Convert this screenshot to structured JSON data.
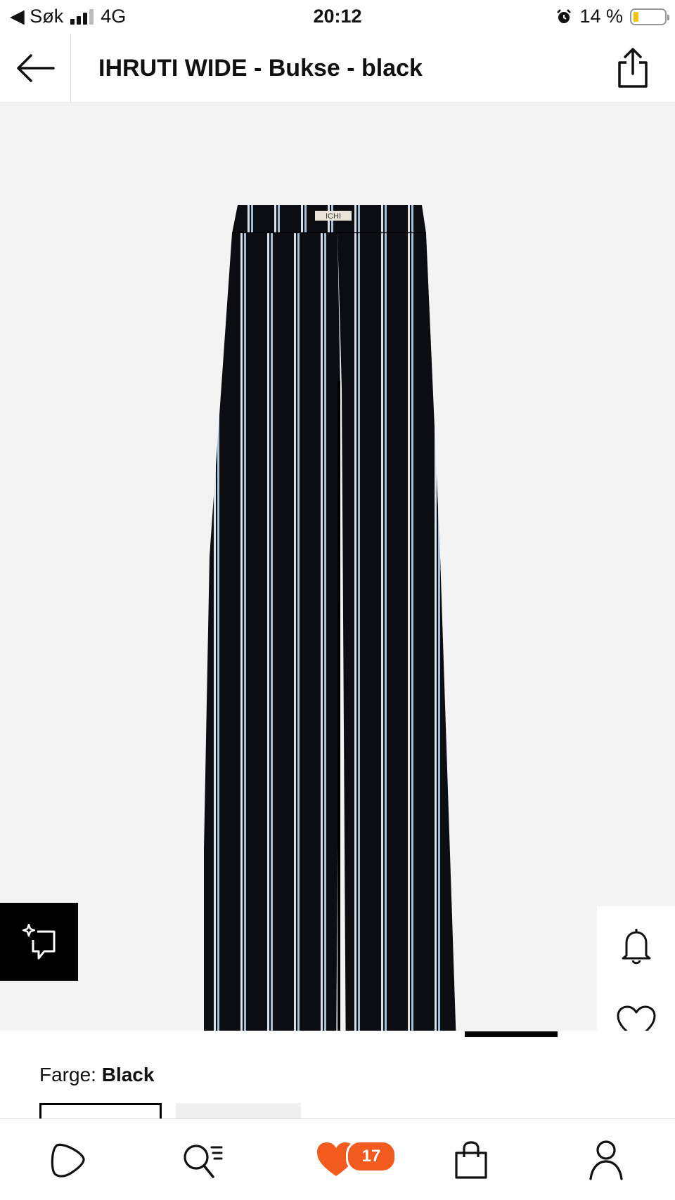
{
  "status_bar": {
    "back_app_label": "◀ Søk",
    "network": "4G",
    "time": "20:12",
    "battery_percent": "14 %",
    "battery_level": 0.14,
    "icons": [
      "signal-icon",
      "alarm-icon",
      "battery-icon"
    ]
  },
  "header": {
    "title": "IHRUTI WIDE - Bukse - black",
    "icons": [
      "back-arrow-icon",
      "share-icon"
    ]
  },
  "product": {
    "image_icon": "striped-trousers-image",
    "brand_tag_text": "ICHI",
    "float_icons": [
      "sparkle-message-icon",
      "bell-icon",
      "heart-icon",
      "shopping-bag-icon"
    ],
    "pager": {
      "active_index": 0
    }
  },
  "color": {
    "label": "Farge:",
    "value": "Black"
  },
  "bottom_nav": {
    "items": [
      "play-icon",
      "search-list-icon",
      "heart-icon",
      "bag-icon",
      "profile-icon"
    ],
    "wishlist_count": "17",
    "accent_color": "#f25a1e"
  }
}
